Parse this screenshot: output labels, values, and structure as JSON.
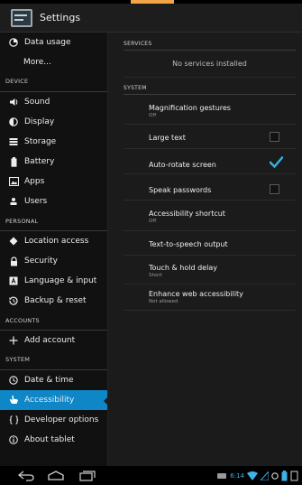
{
  "action_bar": {
    "title": "Settings",
    "icon": "settings-app-icon"
  },
  "left_nav": [
    {
      "type": "item",
      "label": "Data usage",
      "icon": "pie-icon"
    },
    {
      "type": "item",
      "label": "More...",
      "icon": ""
    },
    {
      "type": "header",
      "label": "DEVICE"
    },
    {
      "type": "item",
      "label": "Sound",
      "icon": "speaker-icon"
    },
    {
      "type": "item",
      "label": "Display",
      "icon": "brightness-icon"
    },
    {
      "type": "item",
      "label": "Storage",
      "icon": "storage-icon"
    },
    {
      "type": "item",
      "label": "Battery",
      "icon": "battery-icon"
    },
    {
      "type": "item",
      "label": "Apps",
      "icon": "apps-icon"
    },
    {
      "type": "item",
      "label": "Users",
      "icon": "users-icon"
    },
    {
      "type": "header",
      "label": "PERSONAL"
    },
    {
      "type": "item",
      "label": "Location access",
      "icon": "location-icon"
    },
    {
      "type": "item",
      "label": "Security",
      "icon": "lock-icon"
    },
    {
      "type": "item",
      "label": "Language & input",
      "icon": "keyboard-icon"
    },
    {
      "type": "item",
      "label": "Backup & reset",
      "icon": "backup-icon"
    },
    {
      "type": "header",
      "label": "ACCOUNTS"
    },
    {
      "type": "item",
      "label": "Add account",
      "icon": "plus-icon"
    },
    {
      "type": "header",
      "label": "SYSTEM"
    },
    {
      "type": "item",
      "label": "Date & time",
      "icon": "clock-icon"
    },
    {
      "type": "item",
      "label": "Accessibility",
      "icon": "hand-icon",
      "selected": true
    },
    {
      "type": "item",
      "label": "Developer options",
      "icon": "braces-icon"
    },
    {
      "type": "item",
      "label": "About tablet",
      "icon": "info-icon"
    }
  ],
  "services": {
    "header": "SERVICES",
    "empty_text": "No services installed"
  },
  "system": {
    "header": "SYSTEM",
    "prefs": [
      {
        "title": "Magnification gestures",
        "summary": "Off"
      },
      {
        "title": "Large text",
        "checkbox": false
      },
      {
        "title": "Auto-rotate screen",
        "checkbox": true
      },
      {
        "title": "Speak passwords",
        "checkbox": false
      },
      {
        "title": "Accessibility shortcut",
        "summary": "Off"
      },
      {
        "title": "Text-to-speech output"
      },
      {
        "title": "Touch & hold delay",
        "summary": "Short"
      },
      {
        "title": "Enhance web accessibility",
        "summary": "Not allowed"
      }
    ]
  },
  "status_bar": {
    "time": "6:14"
  },
  "colors": {
    "accent": "#0f86c6",
    "check": "#33b5e5",
    "top_accent": "#f4a54a"
  }
}
